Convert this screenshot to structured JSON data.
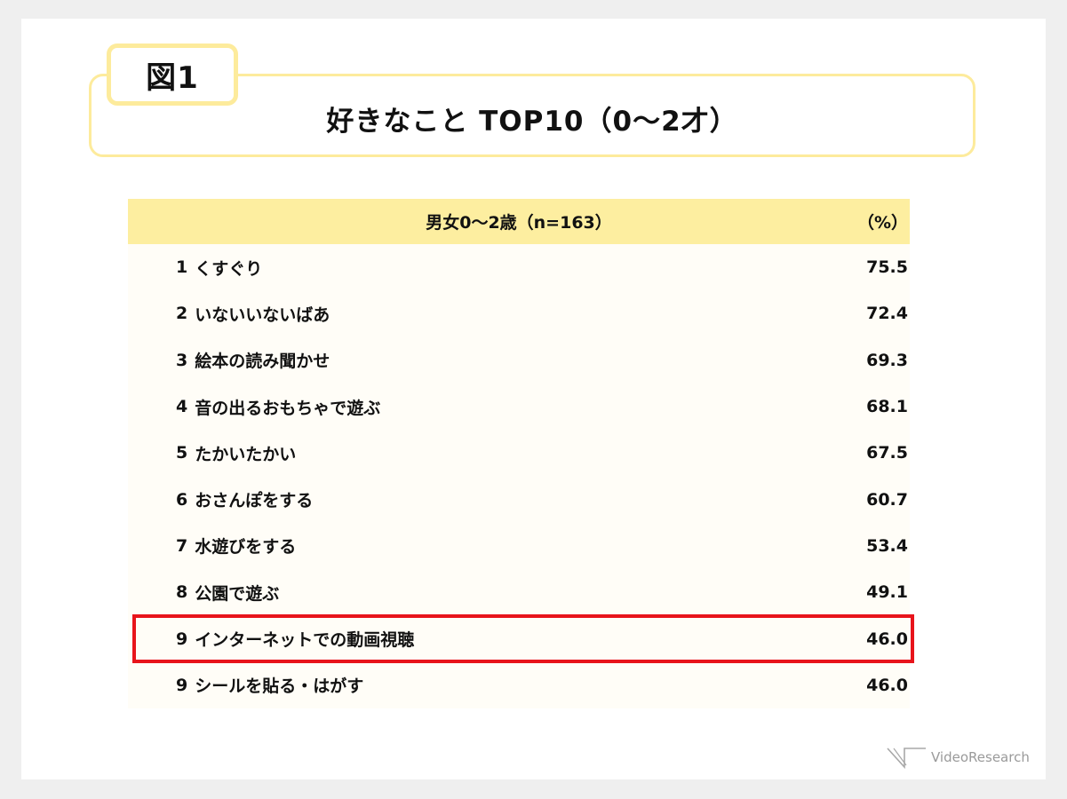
{
  "figure_label": "図1",
  "title": "好きなこと TOP10（0〜2才）",
  "table": {
    "header": "男女0〜2歳（n=163）",
    "unit": "（%）",
    "highlight_color": "#e8141b",
    "header_color": "#fdeea0",
    "rows": [
      {
        "rank": "1",
        "label": "くすぐり",
        "value": "75.5"
      },
      {
        "rank": "2",
        "label": "いないいないばあ",
        "value": "72.4"
      },
      {
        "rank": "3",
        "label": "絵本の読み聞かせ",
        "value": "69.3"
      },
      {
        "rank": "4",
        "label": "音の出るおもちゃで遊ぶ",
        "value": "68.1"
      },
      {
        "rank": "5",
        "label": "たかいたかい",
        "value": "67.5"
      },
      {
        "rank": "6",
        "label": "おさんぽをする",
        "value": "60.7"
      },
      {
        "rank": "7",
        "label": "水遊びをする",
        "value": "53.4"
      },
      {
        "rank": "8",
        "label": "公園で遊ぶ",
        "value": "49.1"
      },
      {
        "rank": "9",
        "label": "インターネットでの動画視聴",
        "value": "46.0",
        "highlighted": true
      },
      {
        "rank": "9",
        "label": "シールを貼る・はがす",
        "value": "46.0"
      }
    ]
  },
  "logo": {
    "text": "VideoResearch",
    "icon": "video-research-logo-icon"
  },
  "chart_data": {
    "type": "table",
    "title": "好きなこと TOP10（0〜2才）",
    "subtitle": "男女0〜2歳（n=163）",
    "unit": "%",
    "columns": [
      "rank",
      "item",
      "value"
    ],
    "categories": [
      "くすぐり",
      "いないいないばあ",
      "絵本の読み聞かせ",
      "音の出るおもちゃで遊ぶ",
      "たかいたかい",
      "おさんぽをする",
      "水遊びをする",
      "公園で遊ぶ",
      "インターネットでの動画視聴",
      "シールを貼る・はがす"
    ],
    "ranks": [
      1,
      2,
      3,
      4,
      5,
      6,
      7,
      8,
      9,
      9
    ],
    "values": [
      75.5,
      72.4,
      69.3,
      68.1,
      67.5,
      60.7,
      53.4,
      49.1,
      46.0,
      46.0
    ],
    "highlighted": [
      "インターネットでの動画視聴"
    ]
  }
}
